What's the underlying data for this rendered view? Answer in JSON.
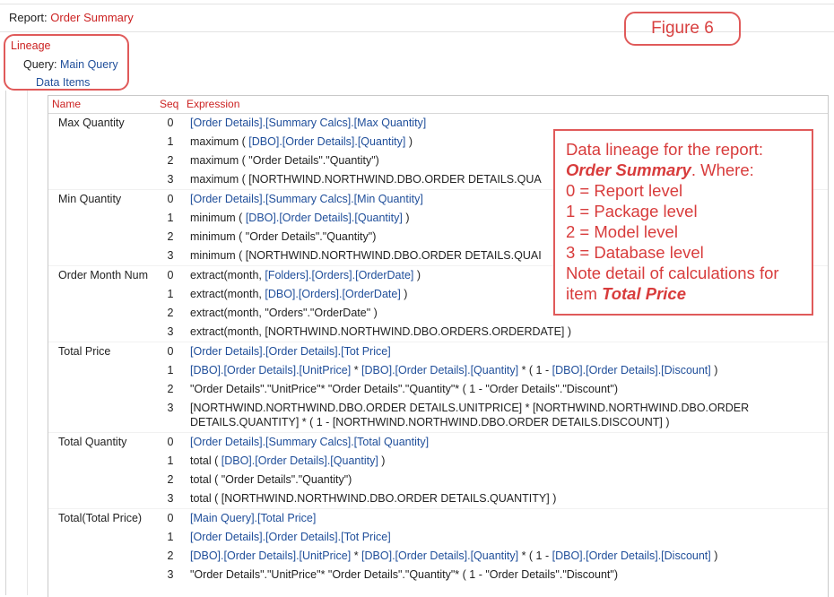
{
  "report": {
    "label": "Report:",
    "name": "Order Summary"
  },
  "figure_label": "Figure 6",
  "tree": {
    "lineage": "Lineage",
    "query_label": "Query:",
    "query_name": "Main Query",
    "data_items": "Data Items"
  },
  "table": {
    "headers": {
      "name": "Name",
      "seq": "Seq",
      "expression": "Expression"
    },
    "rows": [
      {
        "name": "Max Quantity",
        "seq": "0",
        "expr": [
          {
            "t": "[Order Details].[Summary Calcs].[Max Quantity]",
            "link": true
          }
        ]
      },
      {
        "name": "",
        "seq": "1",
        "expr": [
          {
            "t": "maximum ( ",
            "link": false
          },
          {
            "t": "[DBO].[Order Details].[Quantity]",
            "link": true
          },
          {
            "t": " )",
            "link": false
          }
        ]
      },
      {
        "name": "",
        "seq": "2",
        "expr": [
          {
            "t": "maximum ( \"Order Details\".\"Quantity\")",
            "link": false
          }
        ]
      },
      {
        "name": "",
        "seq": "3",
        "expr": [
          {
            "t": "maximum ( [NORTHWIND.NORTHWIND.DBO.ORDER DETAILS.QUA",
            "link": false
          }
        ]
      },
      {
        "name": "Min Quantity",
        "seq": "0",
        "expr": [
          {
            "t": "[Order Details].[Summary Calcs].[Min Quantity]",
            "link": true
          }
        ]
      },
      {
        "name": "",
        "seq": "1",
        "expr": [
          {
            "t": "minimum ( ",
            "link": false
          },
          {
            "t": "[DBO].[Order Details].[Quantity]",
            "link": true
          },
          {
            "t": " )",
            "link": false
          }
        ]
      },
      {
        "name": "",
        "seq": "2",
        "expr": [
          {
            "t": "minimum ( \"Order Details\".\"Quantity\")",
            "link": false
          }
        ]
      },
      {
        "name": "",
        "seq": "3",
        "expr": [
          {
            "t": "minimum ( [NORTHWIND.NORTHWIND.DBO.ORDER DETAILS.QUAI",
            "link": false
          }
        ]
      },
      {
        "name": "Order Month Num",
        "seq": "0",
        "expr": [
          {
            "t": "extract(month, ",
            "link": false
          },
          {
            "t": "[Folders].[Orders].[OrderDate]",
            "link": true
          },
          {
            "t": " )",
            "link": false
          }
        ]
      },
      {
        "name": "",
        "seq": "1",
        "expr": [
          {
            "t": "extract(month, ",
            "link": false
          },
          {
            "t": "[DBO].[Orders].[OrderDate]",
            "link": true
          },
          {
            "t": " )",
            "link": false
          }
        ]
      },
      {
        "name": "",
        "seq": "2",
        "expr": [
          {
            "t": "extract(month, \"Orders\".\"OrderDate\" )",
            "link": false
          }
        ]
      },
      {
        "name": "",
        "seq": "3",
        "expr": [
          {
            "t": "extract(month, [NORTHWIND.NORTHWIND.DBO.ORDERS.ORDERDATE] )",
            "link": false
          }
        ]
      },
      {
        "name": "Total Price",
        "seq": "0",
        "expr": [
          {
            "t": "[Order Details].[Order Details].[Tot Price]",
            "link": true
          }
        ]
      },
      {
        "name": "",
        "seq": "1",
        "expr": [
          {
            "t": "[DBO].[Order Details].[UnitPrice]",
            "link": true
          },
          {
            "t": " * ",
            "link": false
          },
          {
            "t": "[DBO].[Order Details].[Quantity]",
            "link": true
          },
          {
            "t": " * ( 1 - ",
            "link": false
          },
          {
            "t": "[DBO].[Order Details].[Discount]",
            "link": true
          },
          {
            "t": " )",
            "link": false
          }
        ]
      },
      {
        "name": "",
        "seq": "2",
        "expr": [
          {
            "t": "\"Order Details\".\"UnitPrice\"* \"Order Details\".\"Quantity\"* ( 1 - \"Order Details\".\"Discount\")",
            "link": false
          }
        ]
      },
      {
        "name": "",
        "seq": "3",
        "expr": [
          {
            "t": "[NORTHWIND.NORTHWIND.DBO.ORDER DETAILS.UNITPRICE] * [NORTHWIND.NORTHWIND.DBO.ORDER DETAILS.QUANTITY] * ( 1 - [NORTHWIND.NORTHWIND.DBO.ORDER DETAILS.DISCOUNT] )",
            "link": false
          }
        ]
      },
      {
        "name": "Total Quantity",
        "seq": "0",
        "expr": [
          {
            "t": "[Order Details].[Summary Calcs].[Total Quantity]",
            "link": true
          }
        ]
      },
      {
        "name": "",
        "seq": "1",
        "expr": [
          {
            "t": "total ( ",
            "link": false
          },
          {
            "t": "[DBO].[Order Details].[Quantity]",
            "link": true
          },
          {
            "t": " )",
            "link": false
          }
        ]
      },
      {
        "name": "",
        "seq": "2",
        "expr": [
          {
            "t": "total ( \"Order Details\".\"Quantity\")",
            "link": false
          }
        ]
      },
      {
        "name": "",
        "seq": "3",
        "expr": [
          {
            "t": "total ( [NORTHWIND.NORTHWIND.DBO.ORDER DETAILS.QUANTITY] )",
            "link": false
          }
        ]
      },
      {
        "name": "Total(Total Price)",
        "seq": "0",
        "expr": [
          {
            "t": "[Main Query].[Total Price]",
            "link": true
          }
        ]
      },
      {
        "name": "",
        "seq": "1",
        "expr": [
          {
            "t": "[Order Details].[Order Details].[Tot Price]",
            "link": true
          }
        ]
      },
      {
        "name": "",
        "seq": "2",
        "expr": [
          {
            "t": "[DBO].[Order Details].[UnitPrice]",
            "link": true
          },
          {
            "t": " * ",
            "link": false
          },
          {
            "t": "[DBO].[Order Details].[Quantity]",
            "link": true
          },
          {
            "t": " * ( 1 - ",
            "link": false
          },
          {
            "t": "[DBO].[Order Details].[Discount]",
            "link": true
          },
          {
            "t": " )",
            "link": false
          }
        ]
      },
      {
        "name": "",
        "seq": "3",
        "expr": [
          {
            "t": "\"Order Details\".\"UnitPrice\"* \"Order Details\".\"Quantity\"* ( 1 - \"Order Details\".\"Discount\")",
            "link": false
          }
        ]
      }
    ]
  },
  "note": {
    "line1": "Data lineage for the report:",
    "line2_em": "Order Summary",
    "line2_rest": ". Where:",
    "line3": "0 = Report level",
    "line4": "1 = Package level",
    "line5": "2 = Model level",
    "line6": "3 = Database level",
    "line7": "Note detail of calculations for",
    "line8_pre": "item ",
    "line8_em": "Total Price"
  },
  "colors": {
    "accent_red": "#cc2222",
    "callout_red": "#e05a5a",
    "link_blue": "#1f4e9a"
  }
}
